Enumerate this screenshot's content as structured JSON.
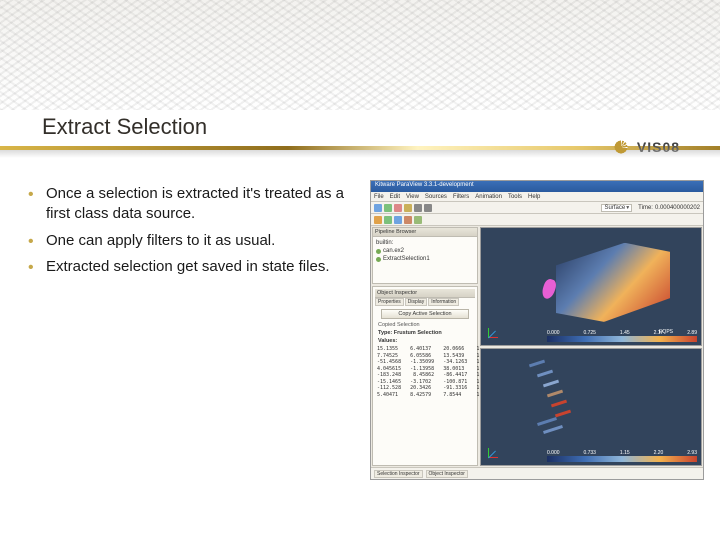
{
  "slide": {
    "title": "Extract Selection",
    "bullets": [
      "Once a selection is extracted it's treated as a first class data source.",
      "One can apply filters to it as usual.",
      "Extracted selection get saved in state files."
    ]
  },
  "logo": {
    "text": "VIS08"
  },
  "app": {
    "window_title": "Kitware ParaView 3.3.1-development",
    "menus": [
      "File",
      "Edit",
      "View",
      "Sources",
      "Filters",
      "Animation",
      "Tools",
      "Help"
    ],
    "representation": "Surface",
    "time_label": "Time:",
    "time_value": "0.000400000202",
    "pipeline": {
      "title": "Pipeline Browser",
      "items": [
        "builtin:",
        "can.ex2",
        "ExtractSelection1"
      ]
    },
    "inspector": {
      "title": "Object Inspector",
      "tabs": [
        "Properties",
        "Display",
        "Information"
      ],
      "copy_button": "Copy Active Selection",
      "section": "Copied Selection",
      "type_label": "Type: Frustum Selection",
      "values_label": "Values:",
      "values": "15.1355    6.40137    20.0666    1\n7.74525    6.05586    13.5439    1\n-51.4568   -1.35099   -34.1263   1\n4.045615   -1.13958   38.0013    1\n-183.248    8.45862   -86.4417   1\n-15.1465   -3.1702    -100.871   1\n-112.528   20.3426    -91.3316   1\n5.40471    8.42579    7.8544     1"
    },
    "status": {
      "selection_inspector": "Selection Inspector",
      "object_inspector": "Object Inspector"
    },
    "colorbar": {
      "var": "EQPS",
      "ticks": [
        "0.000",
        "0.725",
        "1.45",
        "2.17",
        "2.89"
      ]
    },
    "colorbar2": {
      "ticks": [
        "0.000",
        "0.733",
        "1.15",
        "2.20",
        "2.93"
      ]
    }
  }
}
